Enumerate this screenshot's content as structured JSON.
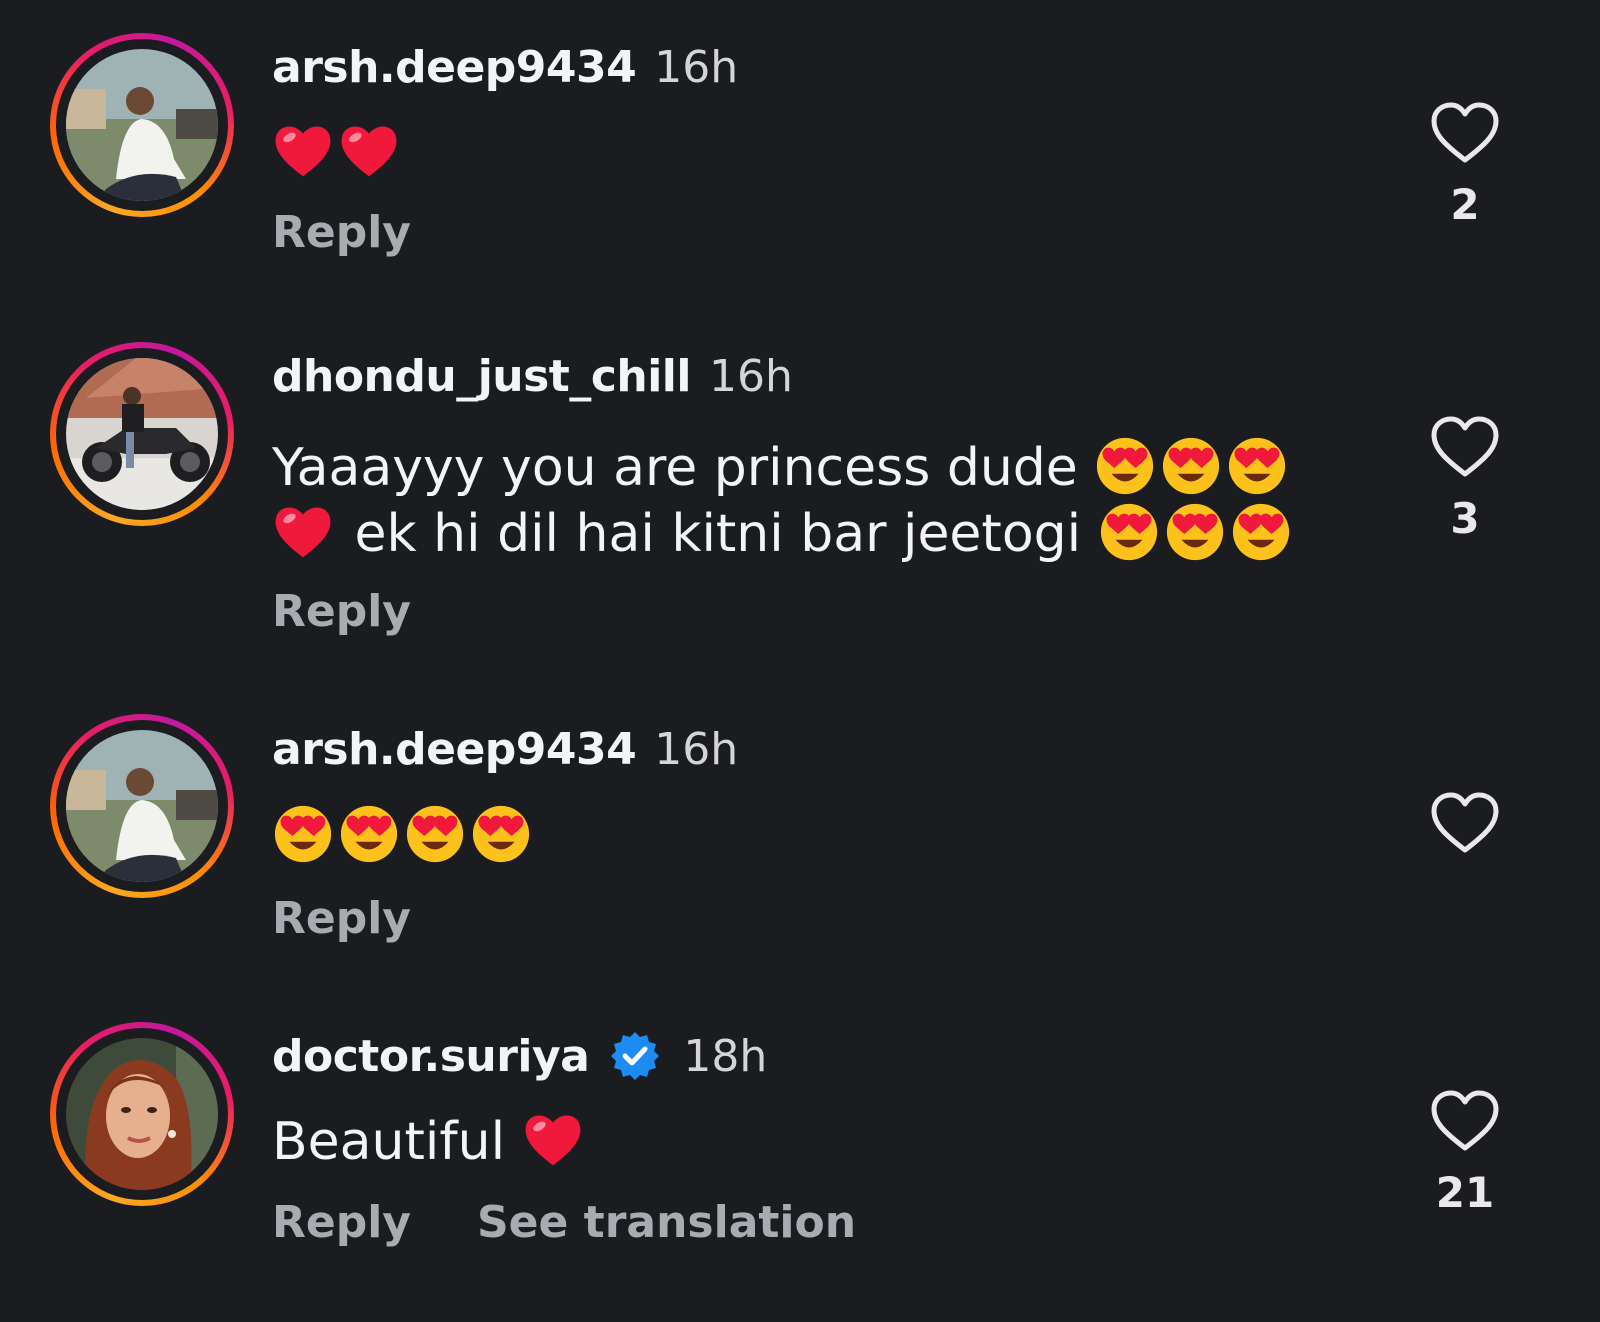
{
  "comments": [
    {
      "username": "arsh.deep9434",
      "time": "16h",
      "verified": false,
      "lines": [
        {
          "text": "",
          "emojis_after": [
            "red-heart",
            "red-heart"
          ]
        }
      ],
      "reply_label": "Reply",
      "likes": "2",
      "avatar": "man-seated-avatar"
    },
    {
      "username": "dhondu_just_chill",
      "time": "16h",
      "verified": false,
      "lines": [
        {
          "text": "Yaaayyy you are princess dude ",
          "emojis_after": [
            "heart-eyes",
            "heart-eyes",
            "heart-eyes"
          ]
        },
        {
          "emojis_before": [
            "red-heart"
          ],
          "text": " ek hi dil hai kitni bar jeetogi ",
          "emojis_after": [
            "heart-eyes",
            "heart-eyes",
            "heart-eyes"
          ]
        }
      ],
      "reply_label": "Reply",
      "likes": "3",
      "avatar": "motorcycle-avatar"
    },
    {
      "username": "arsh.deep9434",
      "time": "16h",
      "verified": false,
      "lines": [
        {
          "text": "",
          "emojis_after": [
            "heart-eyes",
            "heart-eyes",
            "heart-eyes",
            "heart-eyes"
          ]
        }
      ],
      "reply_label": "Reply",
      "likes": "",
      "avatar": "man-seated-avatar"
    },
    {
      "username": "doctor.suriya",
      "time": "18h",
      "verified": true,
      "lines": [
        {
          "text": "Beautiful ",
          "emojis_after": [
            "red-heart"
          ]
        }
      ],
      "reply_label": "Reply",
      "see_translation_label": "See translation",
      "likes": "21",
      "avatar": "woman-portrait-avatar"
    }
  ],
  "colors": {
    "background": "#1b1c20",
    "text_primary": "#f3f4f6",
    "text_secondary": "#a9abb1",
    "verified_blue": "#1d8cf2",
    "heart_red": "#f0193c",
    "emoji_yellow": "#fcc21b"
  }
}
